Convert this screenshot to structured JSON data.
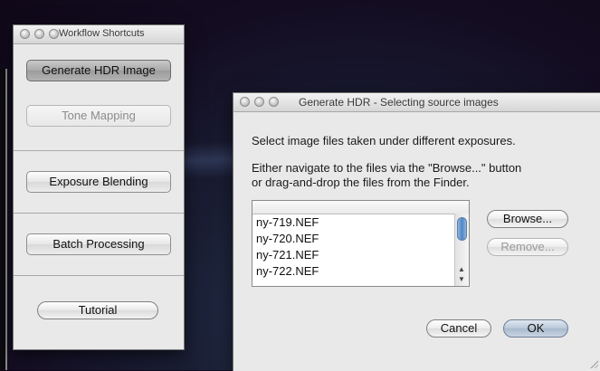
{
  "workflow_window": {
    "title": "Workflow Shortcuts",
    "buttons": {
      "generate_hdr": "Generate HDR Image",
      "tone_mapping": "Tone Mapping",
      "exposure_blending": "Exposure Blending",
      "batch_processing": "Batch Processing",
      "tutorial": "Tutorial"
    }
  },
  "hdr_dialog": {
    "title": "Generate HDR - Selecting source images",
    "instruction_1": "Select image files taken under different exposures.",
    "instruction_2a": "Either navigate to the files via the \"Browse...\" button",
    "instruction_2b": "or drag-and-drop the files from the Finder.",
    "files": [
      "ny-719.NEF",
      "ny-720.NEF",
      "ny-721.NEF",
      "ny-722.NEF"
    ],
    "browse_label": "Browse...",
    "remove_label": "Remove...",
    "cancel_label": "Cancel",
    "ok_label": "OK"
  }
}
